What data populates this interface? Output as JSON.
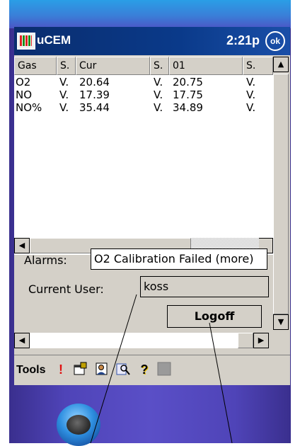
{
  "window": {
    "title": "uCEM",
    "time": "2:21p",
    "ok_label": "ok"
  },
  "table": {
    "headers": [
      "Gas",
      "S.",
      "Cur",
      "S.",
      "01",
      "S."
    ],
    "rows": [
      [
        "O2",
        "V.",
        "20.64",
        "V.",
        "20.75",
        "V."
      ],
      [
        "NO",
        "V.",
        "17.39",
        "V.",
        "17.75",
        "V."
      ],
      [
        "NO%",
        "V.",
        "35.44",
        "V.",
        "34.89",
        "V."
      ]
    ]
  },
  "alarms": {
    "label": "Alarms:",
    "value": "O2 Calibration Failed (more)"
  },
  "user": {
    "label": "Current User:",
    "value": "koss"
  },
  "logoff_label": "Logoff",
  "menubar": {
    "tools_label": "Tools",
    "icons": [
      "alert-icon",
      "properties-icon",
      "user-login-icon",
      "search-icon",
      "help-icon",
      "stop-icon"
    ]
  },
  "colors": {
    "titlebar": "#0a2d6e",
    "device": "#4f44b8",
    "alert": "#e01010"
  }
}
